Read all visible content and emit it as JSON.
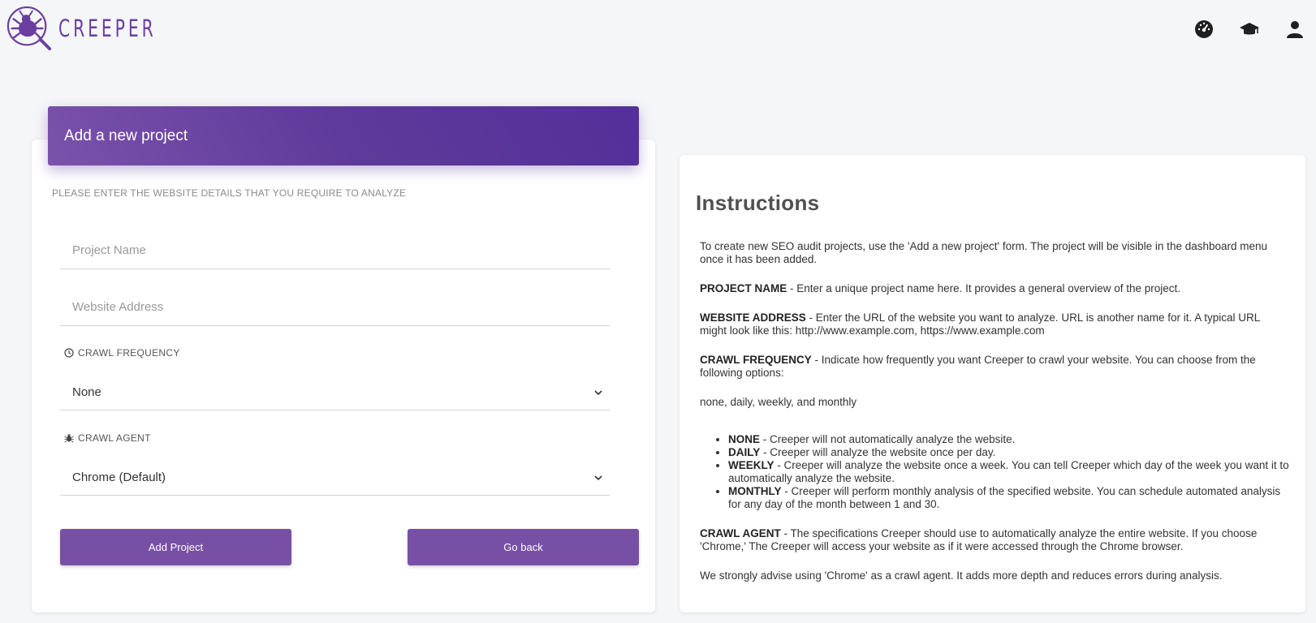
{
  "app": {
    "logo_text": "CREEPER"
  },
  "header_icons": [
    {
      "name": "dashboard-icon"
    },
    {
      "name": "graduation-cap-icon"
    },
    {
      "name": "user-icon"
    }
  ],
  "form": {
    "title": "Add a new project",
    "subtitle": "PLEASE ENTER THE WEBSITE DETAILS THAT YOU REQUIRE TO ANALYZE",
    "project_name": {
      "placeholder": "Project Name",
      "value": ""
    },
    "website_address": {
      "placeholder": "Website Address",
      "value": ""
    },
    "crawl_frequency": {
      "label": "CRAWL FREQUENCY",
      "selected": "None"
    },
    "crawl_agent": {
      "label": "CRAWL AGENT",
      "selected": "Chrome (Default)"
    },
    "add_button": "Add Project",
    "back_button": "Go back"
  },
  "instructions": {
    "title": "Instructions",
    "intro": "To create new SEO audit projects, use the 'Add a new project' form. The project will be visible in the dashboard menu once it has been added.",
    "project_name_term": "PROJECT NAME",
    "project_name_text": " - Enter a unique project name here. It provides a general overview of the project.",
    "website_term": "WEBSITE ADDRESS",
    "website_text": " - Enter the URL of the website you want to analyze. URL is another name for it. A typical URL might look like this: http://www.example.com, https://www.example.com",
    "frequency_term": "CRAWL FREQUENCY",
    "frequency_text": " - Indicate how frequently you want Creeper to crawl your website. You can choose from the following options:",
    "options_line": "none, daily, weekly, and monthly",
    "options": [
      {
        "term": "NONE",
        "text": " - Creeper will not automatically analyze the website."
      },
      {
        "term": "DAILY",
        "text": " - Creeper will analyze the website once per day."
      },
      {
        "term": "WEEKLY",
        "text": " - Creeper will analyze the website once a week. You can tell Creeper which day of the week you want it to automatically analyze the website."
      },
      {
        "term": "MONTHLY",
        "text": " - Creeper will perform monthly analysis of the specified website. You can schedule automated analysis for any day of the month between 1 and 30."
      }
    ],
    "agent_term": "CRAWL AGENT",
    "agent_text": " - The specifications Creeper should use to automatically analyze the entire website. If you choose 'Chrome,' The Creeper will access your website as if it were accessed through the Chrome browser.",
    "advice": "We strongly advise using 'Chrome' as a crawl agent. It adds more depth and reduces errors during analysis."
  },
  "colors": {
    "brand": "#6a3fa0",
    "button": "#7750a5",
    "header_gradient_start": "#7b52ab",
    "header_gradient_end": "#53309a",
    "background": "#f5f6f8"
  }
}
